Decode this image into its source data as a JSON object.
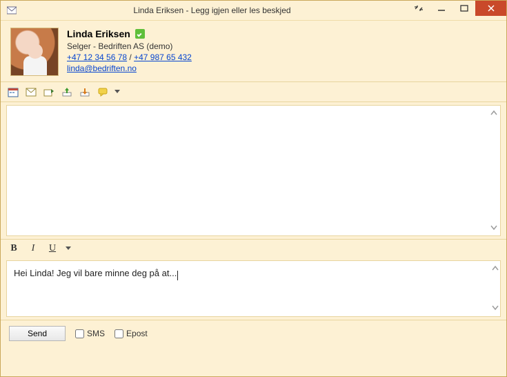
{
  "window": {
    "title": "Linda Eriksen - Legg igjen eller les beskjed"
  },
  "contact": {
    "name": "Linda Eriksen",
    "subtitle": "Selger - Bedriften AS (demo)",
    "phone1": "+47 12 34 56 78",
    "phone2": "+47 987 65 432",
    "phone_sep": " / ",
    "email": "linda@bedriften.no"
  },
  "format": {
    "bold": "B",
    "italic": "I",
    "underline": "U"
  },
  "compose": {
    "text": "Hei Linda! Jeg vil bare minne deg på at..."
  },
  "bottom": {
    "send": "Send",
    "sms": "SMS",
    "epost": "Epost"
  }
}
